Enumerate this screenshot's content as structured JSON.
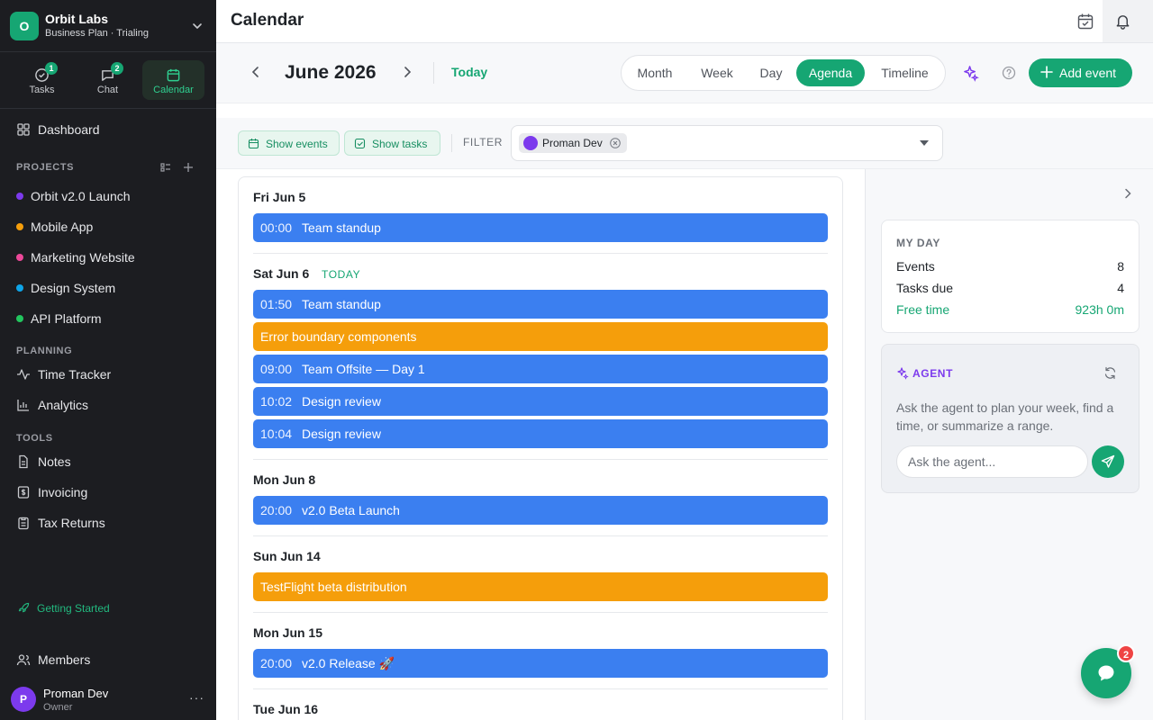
{
  "org": {
    "logo_letter": "O",
    "name": "Orbit Labs",
    "plan": "Business Plan · Trialing"
  },
  "quick": [
    {
      "label": "Tasks",
      "badge": "1",
      "icon": "tasks-icon"
    },
    {
      "label": "Chat",
      "badge": "2",
      "icon": "chat-icon"
    },
    {
      "label": "Calendar",
      "icon": "calendar-icon"
    }
  ],
  "nav": {
    "dashboard": "Dashboard"
  },
  "sections": {
    "projects": "PROJECTS",
    "planning": "PLANNING",
    "tools": "TOOLS"
  },
  "projects": [
    {
      "label": "Orbit v2.0 Launch",
      "color": "#7c3aed"
    },
    {
      "label": "Mobile App",
      "color": "#f59e0b"
    },
    {
      "label": "Marketing Website",
      "color": "#ec4899"
    },
    {
      "label": "Design System",
      "color": "#0ea5e9"
    },
    {
      "label": "API Platform",
      "color": "#22c55e"
    }
  ],
  "planning": [
    {
      "label": "Time Tracker"
    },
    {
      "label": "Analytics"
    }
  ],
  "tools": [
    {
      "label": "Notes"
    },
    {
      "label": "Invoicing"
    },
    {
      "label": "Tax Returns"
    }
  ],
  "getting_started": "Getting Started",
  "members": "Members",
  "user": {
    "initial": "P",
    "name": "Proman Dev",
    "role": "Owner",
    "more": "···"
  },
  "header": {
    "title": "Calendar"
  },
  "toolbar": {
    "month": "June 2026",
    "today": "Today",
    "views": [
      "Month",
      "Week",
      "Day",
      "Agenda",
      "Timeline"
    ],
    "active_view": "Agenda",
    "add_event": "Add event"
  },
  "filters": {
    "show_events": "Show events",
    "show_tasks": "Show tasks",
    "label": "FILTER",
    "tag": "Proman Dev"
  },
  "agenda": [
    {
      "day": "Fri Jun 5",
      "events": [
        {
          "time": "00:00",
          "name": "Team standup",
          "color": "blue"
        }
      ]
    },
    {
      "day": "Sat Jun 6",
      "today_label": "TODAY",
      "events": [
        {
          "time": "01:50",
          "name": "Team standup",
          "color": "blue"
        },
        {
          "time": "",
          "name": "Error boundary components",
          "color": "amber"
        },
        {
          "time": "09:00",
          "name": "Team Offsite — Day 1",
          "color": "blue"
        },
        {
          "time": "10:02",
          "name": "Design review",
          "color": "blue"
        },
        {
          "time": "10:04",
          "name": "Design review",
          "color": "blue"
        }
      ]
    },
    {
      "day": "Mon Jun 8",
      "events": [
        {
          "time": "20:00",
          "name": "v2.0 Beta Launch",
          "color": "blue"
        }
      ]
    },
    {
      "day": "Sun Jun 14",
      "events": [
        {
          "time": "",
          "name": "TestFlight beta distribution",
          "color": "amber"
        }
      ]
    },
    {
      "day": "Mon Jun 15",
      "events": [
        {
          "time": "20:00",
          "name": "v2.0 Release 🚀",
          "color": "blue"
        }
      ]
    },
    {
      "day": "Tue Jun 16",
      "events": []
    }
  ],
  "my_day": {
    "title": "MY DAY",
    "rows": [
      {
        "label": "Events",
        "value": "8"
      },
      {
        "label": "Tasks due",
        "value": "4"
      },
      {
        "label": "Free time",
        "value": "923h 0m"
      }
    ]
  },
  "agent": {
    "title": "AGENT",
    "description": "Ask the agent to plan your week, find a time, or summarize a range.",
    "placeholder": "Ask the agent..."
  },
  "fab": {
    "badge": "2"
  },
  "colors": {
    "accent": "#16a673",
    "event_blue": "#3b7ff0",
    "event_amber": "#f59e0b",
    "sidebar_bg": "#1c1d21"
  }
}
